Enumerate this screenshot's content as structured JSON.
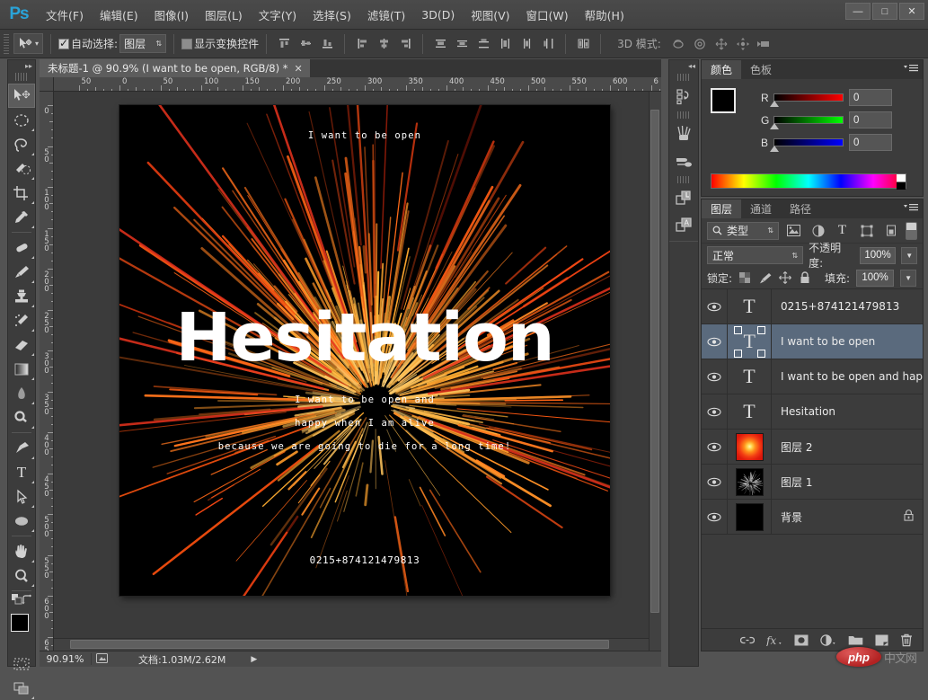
{
  "app": {
    "logo": "Ps",
    "menus": [
      {
        "label": "文件(F)"
      },
      {
        "label": "编辑(E)"
      },
      {
        "label": "图像(I)"
      },
      {
        "label": "图层(L)"
      },
      {
        "label": "文字(Y)"
      },
      {
        "label": "选择(S)"
      },
      {
        "label": "滤镜(T)"
      },
      {
        "label": "3D(D)"
      },
      {
        "label": "视图(V)"
      },
      {
        "label": "窗口(W)"
      },
      {
        "label": "帮助(H)"
      }
    ],
    "window_controls": {
      "minimize": "—",
      "maximize": "□",
      "close": "✕"
    }
  },
  "options_bar": {
    "tool_icon": "move-tool-icon",
    "auto_select_label": "自动选择:",
    "auto_select_checked": true,
    "auto_select_value": "图层",
    "show_transform_label": "显示变换控件",
    "show_transform_checked": false,
    "mode_3d_label": "3D 模式:",
    "align_icons": [
      "align-top-edges-icon",
      "align-vertical-centers-icon",
      "align-bottom-edges-icon",
      "align-left-edges-icon",
      "align-horizontal-centers-icon",
      "align-right-edges-icon"
    ],
    "distribute_icons": [
      "distribute-top-edges-icon",
      "distribute-vertical-centers-icon",
      "distribute-bottom-edges-icon",
      "distribute-left-edges-icon",
      "distribute-horizontal-centers-icon",
      "distribute-right-edges-icon"
    ],
    "auto_align_icon": "auto-align-layers-icon",
    "mode_3d_icons": [
      "orbit-3d-icon",
      "roll-3d-icon",
      "pan-3d-icon",
      "slide-3d-icon",
      "zoom-3d-icon"
    ]
  },
  "toolbox": {
    "tools": [
      {
        "name": "move-tool",
        "selected": true
      },
      {
        "name": "elliptical-marquee-tool",
        "selected": false
      },
      {
        "name": "lasso-tool",
        "selected": false
      },
      {
        "name": "quick-selection-tool",
        "selected": false
      },
      {
        "name": "crop-tool",
        "selected": false
      },
      {
        "name": "eyedropper-tool",
        "selected": false
      },
      {
        "name": "healing-brush-tool",
        "selected": false
      },
      {
        "name": "brush-tool",
        "selected": false
      },
      {
        "name": "clone-stamp-tool",
        "selected": false
      },
      {
        "name": "history-brush-tool",
        "selected": false
      },
      {
        "name": "eraser-tool",
        "selected": false
      },
      {
        "name": "gradient-tool",
        "selected": false
      },
      {
        "name": "blur-tool",
        "selected": false
      },
      {
        "name": "dodge-tool",
        "selected": false
      },
      {
        "name": "pen-tool",
        "selected": false
      },
      {
        "name": "horizontal-type-tool",
        "selected": false
      },
      {
        "name": "path-selection-tool",
        "selected": false
      },
      {
        "name": "ellipse-tool",
        "selected": false
      },
      {
        "name": "hand-tool",
        "selected": false
      },
      {
        "name": "zoom-tool",
        "selected": false
      }
    ],
    "foreground_color": "#000000",
    "background_color": "#ffffff"
  },
  "document": {
    "tab_title": "未标题-1 @ 90.9% (I want to be open, RGB/8) *",
    "close_label": "✕",
    "ruler_h_labels": [
      "50",
      "0",
      "50",
      "100",
      "150",
      "200",
      "250",
      "300",
      "350",
      "400",
      "450",
      "500",
      "550",
      "600",
      "6"
    ],
    "ruler_v_labels": [
      "50",
      "0",
      "50",
      "100",
      "150",
      "200",
      "250",
      "300",
      "350",
      "400",
      "450",
      "500",
      "550",
      "600"
    ],
    "zoom_level": "90.91%",
    "status_text": "文档:1.03M/2.62M",
    "status_arrow": "▶"
  },
  "artwork": {
    "background": "#000000",
    "top_text": "I want to be open",
    "title_text": "Hesitation",
    "line1": "I want to be open and",
    "line2": "happy when I am alive",
    "line3": "because we are going to die for a long time!",
    "number_text": "0215+874121479813"
  },
  "mini_panel": {
    "buttons": [
      {
        "name": "history-panel-icon"
      },
      {
        "name": "brush-panel-icon"
      },
      {
        "name": "brush-presets-icon"
      },
      {
        "name": "layer-comps-icon"
      },
      {
        "name": "character-panel-icon"
      }
    ]
  },
  "color_panel": {
    "tabs": [
      {
        "label": "颜色",
        "active": true
      },
      {
        "label": "色板",
        "active": false
      }
    ],
    "menu_icon": "panel-menu-icon",
    "channels": [
      {
        "label": "R",
        "value": "0",
        "gradient_from": "#000000",
        "gradient_to": "#ff0000"
      },
      {
        "label": "G",
        "value": "0",
        "gradient_from": "#000000",
        "gradient_to": "#00ff00"
      },
      {
        "label": "B",
        "value": "0",
        "gradient_from": "#000000",
        "gradient_to": "#0000ff"
      }
    ],
    "foreground": "#000000",
    "background": "#ffffff"
  },
  "layers_panel": {
    "tabs": [
      {
        "label": "图层",
        "active": true
      },
      {
        "label": "通道",
        "active": false
      },
      {
        "label": "路径",
        "active": false
      }
    ],
    "menu_icon": "panel-menu-icon",
    "filter": {
      "search_icon": "search-icon",
      "kind_label": "类型",
      "filter_icons": [
        "filter-pixel-icon",
        "filter-adjustment-icon",
        "filter-type-icon",
        "filter-shape-icon",
        "filter-smartobject-icon"
      ],
      "toggle_name": "filter-toggle"
    },
    "blend_mode": "正常",
    "opacity_label": "不透明度:",
    "opacity_value": "100%",
    "lock_label": "锁定:",
    "lock_icons": [
      "lock-transparent-pixels-icon",
      "lock-image-pixels-icon",
      "lock-position-icon",
      "lock-all-icon"
    ],
    "fill_label": "填充:",
    "fill_value": "100%",
    "layers": [
      {
        "name": "0215+874121479813",
        "type": "text",
        "visible": true,
        "selected": false,
        "locked": false,
        "thumb": "T"
      },
      {
        "name": "I want to be open",
        "type": "text",
        "visible": true,
        "selected": true,
        "locked": false,
        "thumb": "T"
      },
      {
        "name": "I want to be open and hap...",
        "type": "text",
        "visible": true,
        "selected": false,
        "locked": false,
        "thumb": "T"
      },
      {
        "name": "Hesitation",
        "type": "text",
        "visible": true,
        "selected": false,
        "locked": false,
        "thumb": "T"
      },
      {
        "name": "图层 2",
        "type": "pixel",
        "visible": true,
        "selected": false,
        "locked": false,
        "thumb": "red-glow"
      },
      {
        "name": "图层 1",
        "type": "pixel",
        "visible": true,
        "selected": false,
        "locked": false,
        "thumb": "burst"
      },
      {
        "name": "背景",
        "type": "pixel",
        "visible": true,
        "selected": false,
        "locked": true,
        "thumb": "black"
      }
    ],
    "footer_buttons": [
      {
        "name": "link-layers-icon",
        "glyph": "⛓"
      },
      {
        "name": "layer-style-icon",
        "glyph": "fx"
      },
      {
        "name": "layer-mask-icon",
        "glyph": "◉"
      },
      {
        "name": "adjustment-layer-icon",
        "glyph": "◑"
      },
      {
        "name": "new-group-icon",
        "glyph": "▭"
      },
      {
        "name": "new-layer-icon",
        "glyph": "▧"
      },
      {
        "name": "delete-layer-icon",
        "glyph": "🗑"
      }
    ]
  },
  "watermark": {
    "logo_text": "php",
    "site_text": "中文网"
  }
}
